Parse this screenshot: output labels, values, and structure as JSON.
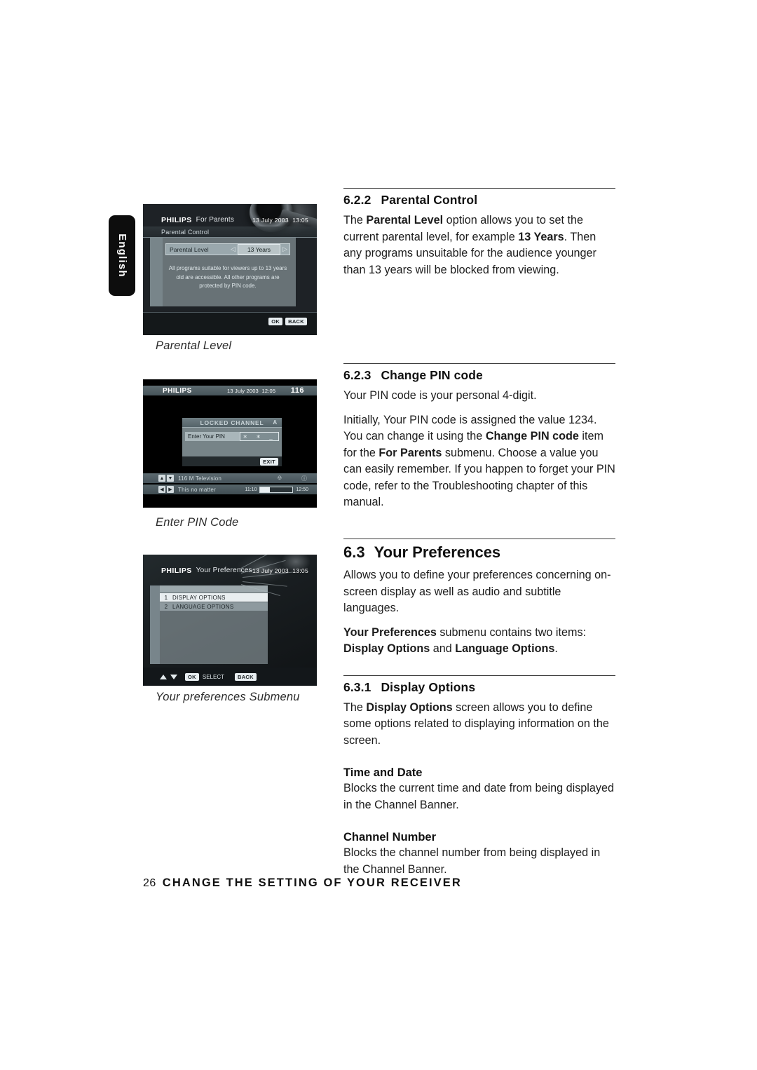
{
  "page": {
    "language_tab": "English",
    "footer_page_number": "26",
    "footer_title": "CHANGE THE SETTING OF YOUR RECEIVER"
  },
  "figures": [
    {
      "caption": "Parental Level",
      "screen": {
        "brand": "PHILIPS",
        "header_title": "For Parents",
        "header_date": "13 July 2003",
        "header_time": "13:05",
        "subbar_title": "Parental Control",
        "row_label": "Parental Level",
        "row_value": "13 Years",
        "left_arrow": "◁",
        "right_arrow": "▷",
        "description": "All programs suitable for viewers up to 13 years old are accessible.  All other programs are protected by PIN code.",
        "key_ok": "OK",
        "key_back": "BACK"
      }
    },
    {
      "caption": "Enter PIN Code",
      "screen": {
        "brand": "PHILIPS",
        "header_date": "13 July 2003",
        "header_time": "12:05",
        "channel_number": "116",
        "dialog_title": "LOCKED CHANNEL",
        "lock_icon": "A",
        "field_label": "Enter Your PIN",
        "field_value": "∗ ∗ _",
        "key_exit": "EXIT",
        "banner_channel": "116 M Television",
        "banner_program": "This no matter",
        "banner_start": "11:10",
        "banner_end": "12:50",
        "banner_progress_percent": 30
      }
    },
    {
      "caption": "Your preferences Submenu",
      "screen": {
        "brand": "PHILIPS",
        "header_title": "Your Preferences",
        "header_date": "13 July 2003",
        "header_time": "13:05",
        "items": [
          {
            "num": "1",
            "label": "DISPLAY OPTIONS",
            "selected": true
          },
          {
            "num": "2",
            "label": "LANGUAGE OPTIONS",
            "selected": false
          }
        ],
        "key_ok": "OK",
        "key_select": "SELECT",
        "key_back": "BACK"
      }
    }
  ],
  "sections": {
    "s622": {
      "number": "6.2.2",
      "title": "Parental Control",
      "para1_a": "The ",
      "para1_b": "Parental Level",
      "para1_c": " option allows you to set the current parental level, for example ",
      "para1_d": "13 Years",
      "para1_e": ". Then any programs unsuitable for the audience younger than 13 years will be blocked from viewing."
    },
    "s623": {
      "number": "6.2.3",
      "title": "Change PIN code",
      "para1": "Your PIN code is your personal 4-digit.",
      "para2_a": "Initially, Your PIN code is assigned the value 1234. You can change it using the ",
      "para2_b": "Change PIN code",
      "para2_c": " item for the ",
      "para2_d": "For Parents",
      "para2_e": " submenu. Choose a value you can easily remember. If you happen to forget your PIN code, refer to the Troubleshooting chapter of this manual."
    },
    "s63": {
      "number": "6.3",
      "title": "Your Preferences",
      "para1": "Allows you to define your preferences concerning on-screen display as well as audio and subtitle languages.",
      "para2_a": "Your Preferences",
      "para2_b": " submenu contains two items: ",
      "para2_c": "Display Options",
      "para2_d": " and ",
      "para2_e": "Language Options",
      "para2_f": "."
    },
    "s631": {
      "number": "6.3.1",
      "title": "Display Options",
      "para1_a": "The ",
      "para1_b": "Display Options",
      "para1_c": " screen allows you to define some options related to displaying information on the screen.",
      "sub1_title": "Time and Date",
      "sub1_body": "Blocks the current time and date from being displayed in the Channel Banner.",
      "sub2_title": "Channel Number",
      "sub2_body": "Blocks the channel number from being displayed in the Channel Banner."
    }
  }
}
